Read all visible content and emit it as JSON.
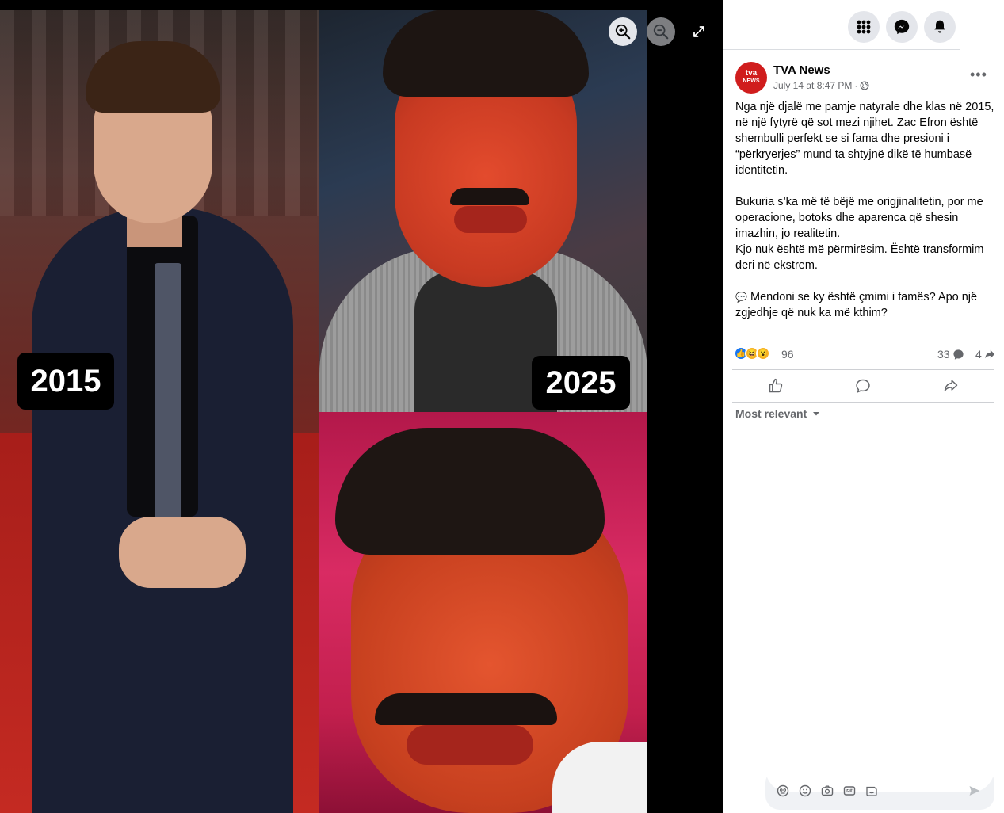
{
  "viewer": {
    "badge_left": "2015",
    "badge_right": "2025",
    "controls": [
      "zoom-in-icon",
      "zoom-out-icon",
      "fullscreen-icon"
    ]
  },
  "topbar": {
    "icons": [
      "menu-grid-icon",
      "messenger-icon",
      "notifications-bell-icon"
    ]
  },
  "post": {
    "page_name": "TVA News",
    "avatar_text": "tva",
    "avatar_sub": "NEWS",
    "timestamp": "July 14 at 8:47 PM",
    "meta_sep": "·",
    "more_label": "•••",
    "text": {
      "p1": "Nga një djalë me pamje natyrale dhe klas në 2015, në një fytyrë që sot mezi njihet. Zac Efron është shembulli perfekt se si fama dhe presioni i “përkryerjes” mund ta shtyjnë dikë të humbasë identitetin.",
      "p2a": "Bukuria s’ka më të bëjë me origjinalitetin, por me operacione, botoks dhe aparenca që shesin imazhin, jo realitetin.",
      "p2b": "Kjo nuk është më përmirësim. Është transformim deri në ekstrem.",
      "p3_emoji": "💬",
      "p3": "Mendoni se ky është çmimi i famës? Apo një zgjedhje që nuk ka më kthim?"
    },
    "reactions": {
      "count": "96",
      "comments": "33",
      "shares": "4"
    },
    "sort_label": "Most relevant"
  },
  "colors": {
    "accent": "#1877f2",
    "muted": "#65676b",
    "divider": "#ced0d4",
    "brand_red": "#d01d1d"
  }
}
